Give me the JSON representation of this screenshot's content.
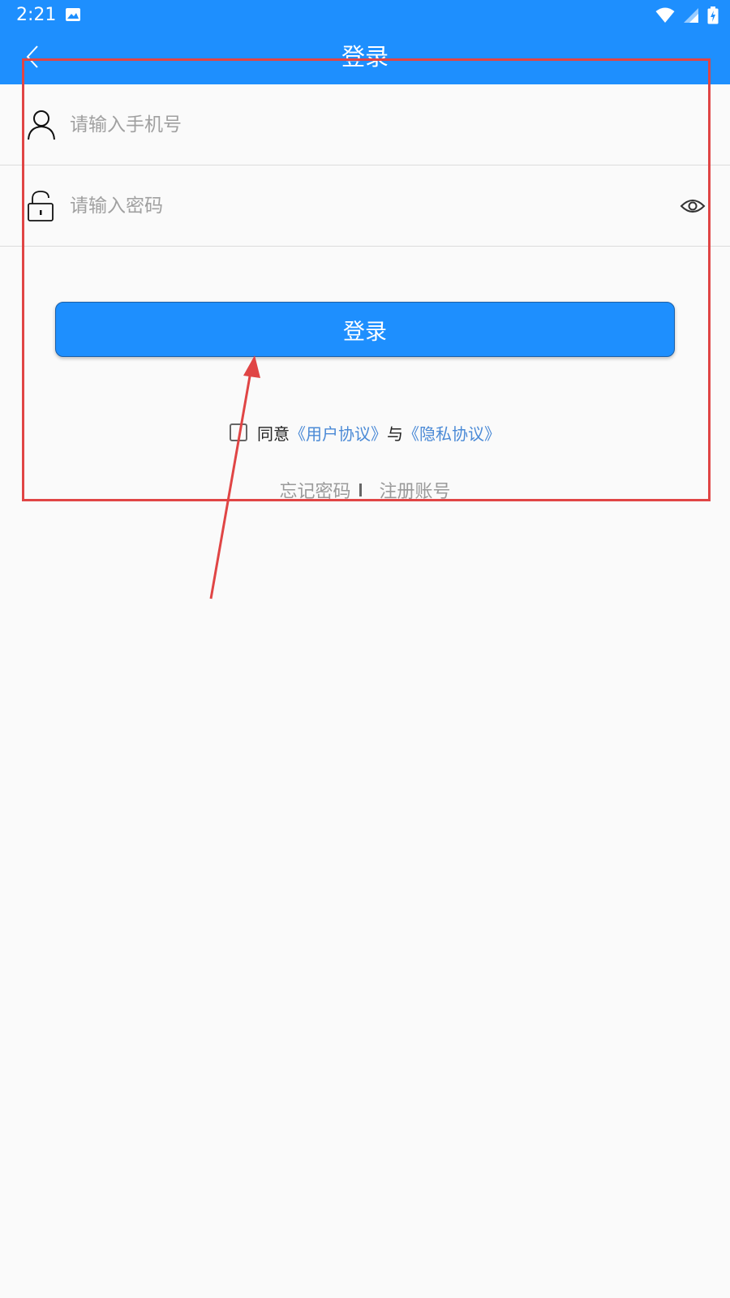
{
  "status_bar": {
    "time": "2:21"
  },
  "app_bar": {
    "title": "登录"
  },
  "form": {
    "phone_placeholder": "请输入手机号",
    "password_placeholder": "请输入密码"
  },
  "login_button": {
    "label": "登录"
  },
  "agreement": {
    "prefix": "同意",
    "user_agreement": "《用户协议》",
    "conjunction": "与",
    "privacy_agreement": "《隐私协议》"
  },
  "links": {
    "forgot_password": "忘记密码",
    "register": "注册账号"
  },
  "icons": {
    "back": "chevron-left-icon",
    "user": "user-icon",
    "lock": "lock-icon",
    "eye": "eye-icon",
    "wifi": "wifi-icon",
    "signal": "signal-icon",
    "battery": "battery-icon",
    "image": "image-icon"
  },
  "colors": {
    "primary": "#1e8ffe",
    "link": "#4b8ad6",
    "annotation": "#e04545",
    "placeholder": "#a0a0a0",
    "background": "#fafafa"
  }
}
